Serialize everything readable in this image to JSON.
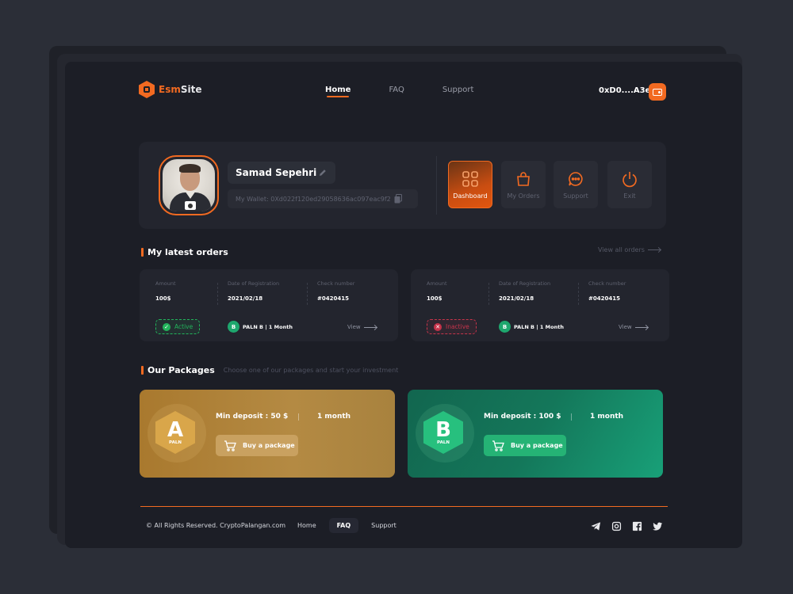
{
  "brand": {
    "name_part1": "Esm",
    "name_part2": "Site",
    "accent": "#f26a21"
  },
  "nav": [
    {
      "label": "Home",
      "active": true
    },
    {
      "label": "FAQ",
      "active": false
    },
    {
      "label": "Support",
      "active": false
    }
  ],
  "wallet": {
    "address_short": "0xD0....A3ea",
    "icon": "wallet-icon"
  },
  "profile": {
    "name": "Samad Sepehri",
    "wallet_full": "My Wallet: 0Xd022f120ed29058636ac097eac9f2",
    "avatar_icon": "camera-icon"
  },
  "actions": [
    {
      "label": "Dashboard",
      "icon": "dashboard-icon",
      "active": true
    },
    {
      "label": "My Orders",
      "icon": "bag-icon",
      "active": false
    },
    {
      "label": "Support",
      "icon": "chat-icon",
      "active": false
    },
    {
      "label": "Exit",
      "icon": "power-icon",
      "active": false
    }
  ],
  "orders_section": {
    "title": "My latest orders",
    "view_all": "View all orders"
  },
  "orders": [
    {
      "amount_label": "Amount",
      "amount": "100$",
      "date_label": "Date of Registration",
      "date": "2021/02/18",
      "check_label": "Check number",
      "check": "#0420415",
      "status": "Active",
      "status_color": "#22b45b",
      "plan_badge": "B",
      "plan": "PALN B | 1 Month",
      "view": "View"
    },
    {
      "amount_label": "Amount",
      "amount": "100$",
      "date_label": "Date of Registration",
      "date": "2021/02/18",
      "check_label": "Check number",
      "check": "#0420415",
      "status": "Inactive",
      "status_color": "#c6344b",
      "plan_badge": "B",
      "plan": "PALN B | 1 Month",
      "view": "View"
    }
  ],
  "packages_section": {
    "title": "Our Packages",
    "subtitle": "Choose one of our packages and start your investment"
  },
  "packages": [
    {
      "letter": "A",
      "sub": "PALN",
      "deposit": "Min deposit : 50 $",
      "separator": "|",
      "duration": "1 month",
      "button": "Buy a package",
      "color": "#b0853c"
    },
    {
      "letter": "B",
      "sub": "PALN",
      "deposit": "Min deposit : 100 $",
      "separator": "|",
      "duration": "1 month",
      "button": "Buy a package",
      "color": "#14775a"
    }
  ],
  "footer": {
    "copyright": "© All Rights Reserved. CryptoPalangan.com",
    "links": [
      {
        "label": "Home",
        "selected": false
      },
      {
        "label": "FAQ",
        "selected": true
      },
      {
        "label": "Support",
        "selected": false
      }
    ],
    "social": [
      "telegram-icon",
      "instagram-icon",
      "facebook-icon",
      "twitter-icon"
    ]
  }
}
